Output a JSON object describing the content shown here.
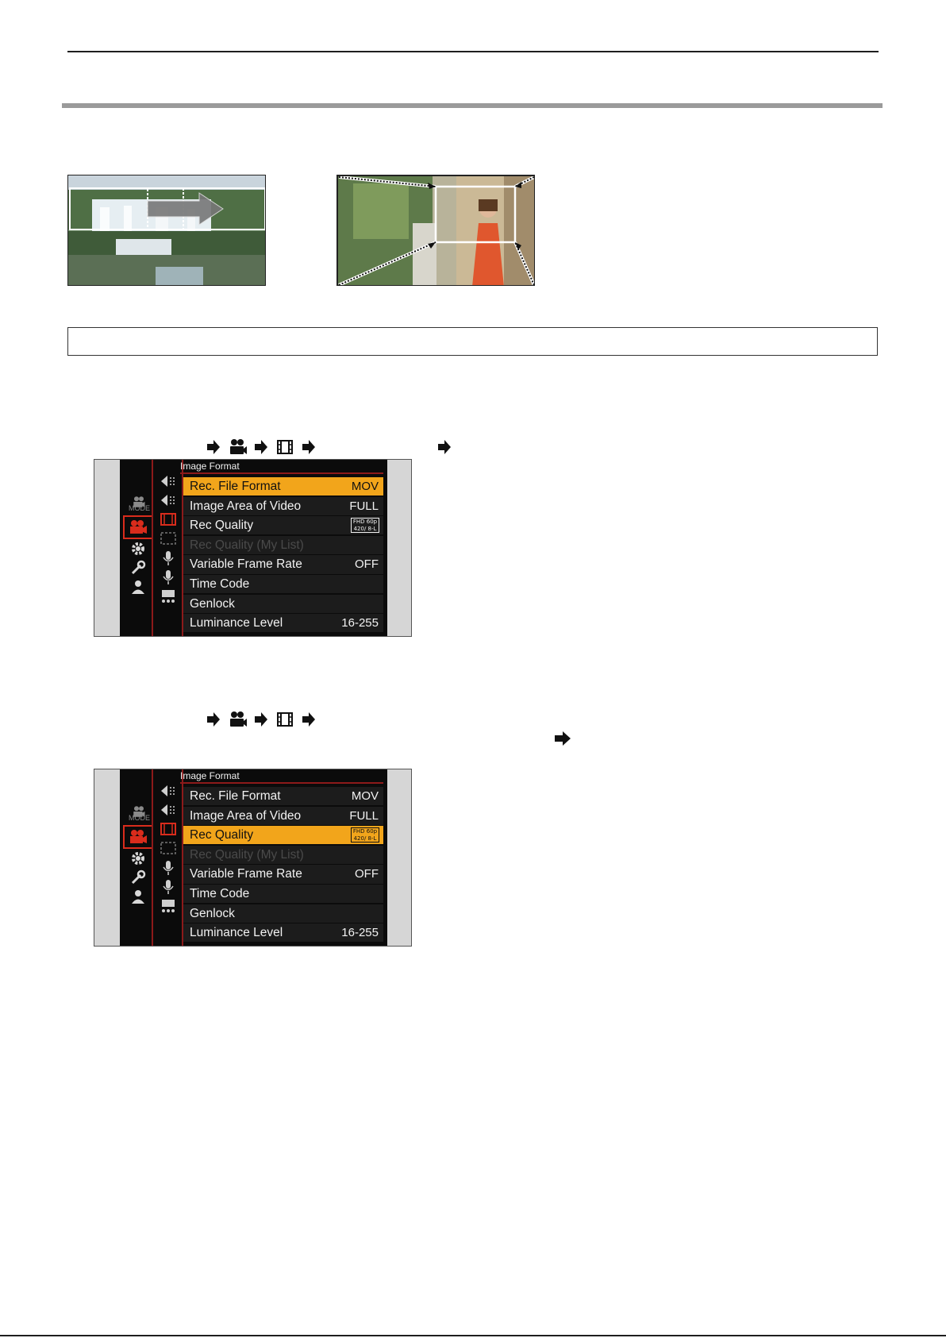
{
  "icons": {
    "arrow": "right-arrow-icon",
    "video": "motion-picture-camera-icon",
    "film": "film-frame-icon",
    "arrow_bold": "bold-right-arrow-icon"
  },
  "colors": {
    "highlight": "#f2a51b",
    "active_tab": "#d92c1c",
    "menu_background": "#0b0b0b",
    "item_background": "#1c1c1c",
    "accent_line": "#8c1a1a"
  },
  "menus": [
    {
      "header": "Image Format",
      "mode_label": "MODE",
      "items": [
        {
          "label": "Rec. File Format",
          "value": "MOV",
          "selected": true
        },
        {
          "label": "Image Area of Video",
          "value": "FULL"
        },
        {
          "label": "Rec Quality",
          "badge": "FHD 60p\n420/ 8-L"
        },
        {
          "label": "Rec Quality (My List)",
          "dimmed": true
        },
        {
          "label": "Variable Frame Rate",
          "value": "OFF"
        },
        {
          "label": "Time Code"
        },
        {
          "label": "Genlock"
        },
        {
          "label": "Luminance Level",
          "value": "16-255"
        }
      ]
    },
    {
      "header": "Image Format",
      "mode_label": "MODE",
      "items": [
        {
          "label": "Rec. File Format",
          "value": "MOV"
        },
        {
          "label": "Image Area of Video",
          "value": "FULL"
        },
        {
          "label": "Rec Quality",
          "badge": "FHD 60p\n420/ 8-L",
          "selected": true
        },
        {
          "label": "Rec Quality (My List)",
          "dimmed": true
        },
        {
          "label": "Variable Frame Rate",
          "value": "OFF"
        },
        {
          "label": "Time Code"
        },
        {
          "label": "Genlock"
        },
        {
          "label": "Luminance Level",
          "value": "16-255"
        }
      ]
    }
  ]
}
